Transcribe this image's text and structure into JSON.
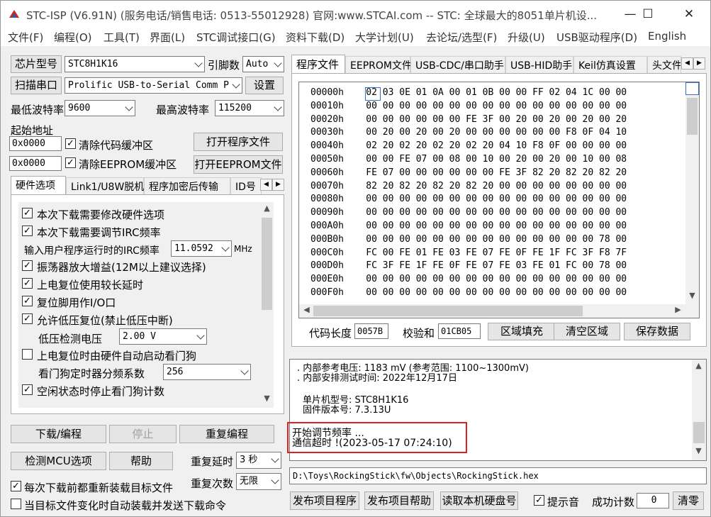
{
  "window": {
    "title": "STC-ISP (V6.91N) (服务电话/销售电话: 0513-55012928) 官网:www.STCAI.com  -- STC: 全球最大的8051单片机设...",
    "minimize": "—",
    "maximize": "☐",
    "close": "✕"
  },
  "menu": [
    "文件(F)",
    "编程(O)",
    "工具(T)",
    "界面(L)",
    "STC调试接口(G)",
    "资料下载(D)",
    "大学计划(U)",
    "去论坛/选型(F)",
    "升级(U)",
    "USB驱动程序(D)",
    "English"
  ],
  "left": {
    "chip_btn": "芯片型号",
    "chip_value": "STC8H1K16",
    "pin_label": "引脚数",
    "pin_value": "Auto",
    "scan_btn": "扫描串口",
    "port_value": "Prolific USB-to-Serial Comm P",
    "settings_btn": "设置",
    "min_baud_label": "最低波特率",
    "min_baud": "9600",
    "max_baud_label": "最高波特率",
    "max_baud": "115200",
    "start_addr_label": "起始地址",
    "code_addr": "0x0000",
    "clear_code": "清除代码缓冲区",
    "open_prog": "打开程序文件",
    "eeprom_addr": "0x0000",
    "clear_eeprom": "清除EEPROM缓冲区",
    "open_eeprom": "打开EEPROM文件",
    "tabs": [
      "硬件选项",
      "Link1/U8W脱机",
      "程序加密后传输",
      "ID号"
    ],
    "options": {
      "o1": "本次下载需要修改硬件选项",
      "o2": "本次下载需要调节IRC频率",
      "irc_label": "输入用户程序运行时的IRC频率",
      "irc_value": "11.0592",
      "irc_unit": "MHz",
      "o3": "振荡器放大增益(12M以上建议选择)",
      "o4": "上电复位使用较长延时",
      "o5": "复位脚用作I/O口",
      "o6": "允许低压复位(禁止低压中断)",
      "lv_label": "低压检测电压",
      "lv_value": "2.00 V",
      "o7": "上电复位时由硬件自动启动看门狗",
      "wdt_label": "看门狗定时器分频系数",
      "wdt_value": "256",
      "o8": "空闲状态时停止看门狗计数"
    },
    "download_btn": "下载/编程",
    "stop_btn": "停止",
    "reprogram_btn": "重复编程",
    "detect_btn": "检测MCU选项",
    "help_btn": "帮助",
    "repeat_delay_label": "重复延时",
    "repeat_delay": "3 秒",
    "repeat_count_label": "重复次数",
    "repeat_count": "无限",
    "reload_each": "每次下载前都重新装载目标文件",
    "auto_send": "当目标文件变化时自动装载并发送下载命令"
  },
  "right": {
    "tabs": [
      "程序文件",
      "EEPROM文件",
      "USB-CDC/串口助手",
      "USB-HID助手",
      "Keil仿真设置",
      "头文件"
    ],
    "hex_rows": [
      {
        "addr": "00000h",
        "bytes": "02 03 0E 01 0A 00 01 0B 00 00 FF 02 04 1C 00 00"
      },
      {
        "addr": "00010h",
        "bytes": "00 00 00 00 00 00 00 00 00 00 00 00 00 00 00 00"
      },
      {
        "addr": "00020h",
        "bytes": "00 00 00 00 00 00 FE 3F 00 20 00 20 00 20 00 20"
      },
      {
        "addr": "00030h",
        "bytes": "00 20 00 20 00 20 00 00 00 00 00 00 F8 0F 04 10"
      },
      {
        "addr": "00040h",
        "bytes": "02 20 02 20 02 20 02 20 04 10 F8 0F 00 00 00 00"
      },
      {
        "addr": "00050h",
        "bytes": "00 00 FE 07 00 08 00 10 00 20 00 20 00 10 00 08"
      },
      {
        "addr": "00060h",
        "bytes": "FE 07 00 00 00 00 00 00 FE 3F 82 20 82 20 82 20"
      },
      {
        "addr": "00070h",
        "bytes": "82 20 82 20 82 20 82 20 00 00 00 00 00 00 00 00"
      },
      {
        "addr": "00080h",
        "bytes": "00 00 00 00 00 00 00 00 00 00 00 00 00 00 00 00"
      },
      {
        "addr": "00090h",
        "bytes": "00 00 00 00 00 00 00 00 00 00 00 00 00 00 00 00"
      },
      {
        "addr": "000A0h",
        "bytes": "00 00 00 00 00 00 00 00 00 00 00 00 00 00 00 00"
      },
      {
        "addr": "000B0h",
        "bytes": "00 00 00 00 00 00 00 00 00 00 00 00 00 00 78 00"
      },
      {
        "addr": "000C0h",
        "bytes": "FC 00 FE 01 FE 03 FE 07 FE 0F FE 1F FC 3F F8 7F"
      },
      {
        "addr": "000D0h",
        "bytes": "FC 3F FE 1F FE 0F FE 07 FE 03 FE 01 FC 00 78 00"
      },
      {
        "addr": "000E0h",
        "bytes": "00 00 00 00 00 00 00 00 00 00 00 00 00 00 00 00"
      },
      {
        "addr": "000F0h",
        "bytes": "00 00 00 00 00 00 00 00 00 00 00 00 00 00 00 00"
      }
    ],
    "code_len_label": "代码长度",
    "code_len": "0057B",
    "checksum_label": "校验和",
    "checksum": "01CB05",
    "fill_btn": "区域填充",
    "clear_btn": "清空区域",
    "save_btn": "保存数据",
    "log": {
      "l1": ". 内部参考电压: 1183 mV (参考范围: 1100~1300mV)",
      "l2": ". 内部安排测试时间: 2022年12月17日",
      "l3": "单片机型号: STC8H1K16",
      "l4": "固件版本号: 7.3.13U",
      "l5": "开始调节频率 ...",
      "l6": "通信超时 !(2023-05-17 07:24:10)"
    },
    "file_path": "D:\\Toys\\RockingStick\\fw\\Objects\\RockingStick.hex",
    "publish_btn": "发布项目程序",
    "publish_help_btn": "发布项目帮助",
    "read_disk_btn": "读取本机硬盘号",
    "beep_label": "提示音",
    "success_label": "成功计数",
    "success_count": "0",
    "reset_btn": "清零"
  }
}
